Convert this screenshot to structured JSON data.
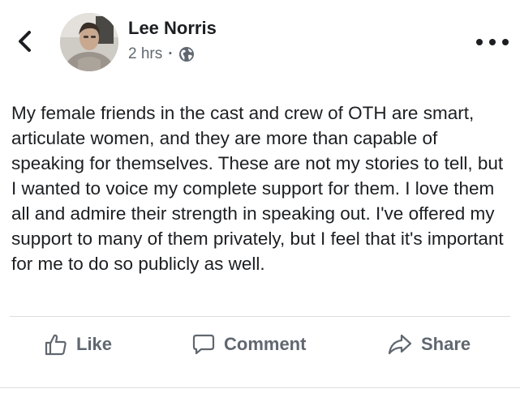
{
  "post": {
    "author": "Lee Norris",
    "timestamp": "2 hrs",
    "separator": "·",
    "privacy_icon": "globe-icon",
    "body": "My female friends in the cast and crew of OTH are smart, articulate women, and they are more than capable of speaking for themselves. These are not my stories to tell, but I wanted to voice my complete support for them. I love them all and admire their strength in speaking out. I've offered my support to many of them privately, but I feel that it's important for me to do so publicly as well."
  },
  "actions": {
    "like_label": "Like",
    "comment_label": "Comment",
    "share_label": "Share"
  },
  "colors": {
    "text": "#1c1e21",
    "secondary": "#606770",
    "divider": "#dadde1"
  }
}
